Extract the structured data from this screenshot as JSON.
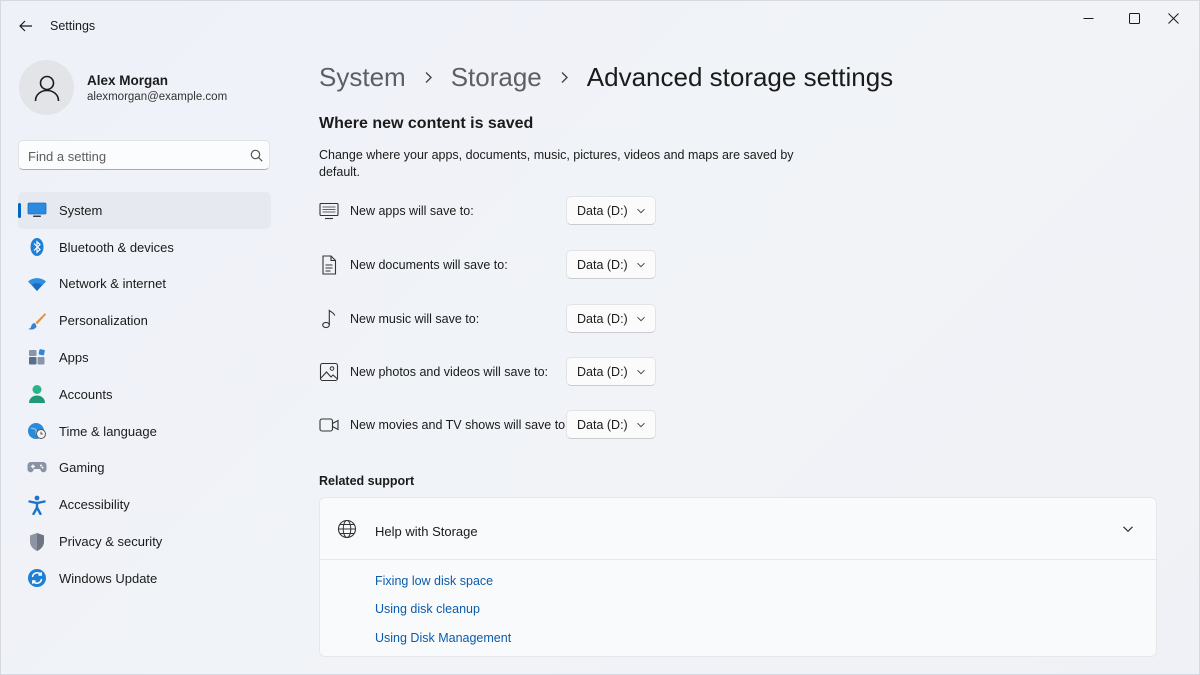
{
  "window": {
    "title": "Settings"
  },
  "profile": {
    "name": "Alex Morgan",
    "email": "alexmorgan@example.com"
  },
  "search": {
    "placeholder": "Find a setting"
  },
  "nav": {
    "selected": "System",
    "items": [
      {
        "label": "System",
        "icon": "monitor-icon"
      },
      {
        "label": "Bluetooth & devices",
        "icon": "bluetooth-icon"
      },
      {
        "label": "Network & internet",
        "icon": "wifi-icon"
      },
      {
        "label": "Personalization",
        "icon": "brush-icon"
      },
      {
        "label": "Apps",
        "icon": "apps-icon"
      },
      {
        "label": "Accounts",
        "icon": "person-icon"
      },
      {
        "label": "Time & language",
        "icon": "globe-clock-icon"
      },
      {
        "label": "Gaming",
        "icon": "gamepad-icon"
      },
      {
        "label": "Accessibility",
        "icon": "accessibility-icon"
      },
      {
        "label": "Privacy & security",
        "icon": "shield-icon"
      },
      {
        "label": "Windows Update",
        "icon": "sync-icon"
      }
    ]
  },
  "breadcrumb": {
    "items": [
      "System",
      "Storage"
    ],
    "current": "Advanced storage settings"
  },
  "content": {
    "section_title": "Where new content is saved",
    "section_desc": "Change where your apps, documents, music, pictures, videos and maps are saved by default.",
    "save_locations": [
      {
        "label": "New apps will save to:",
        "value": "Data (D:)",
        "icon": "monitor-icon"
      },
      {
        "label": "New documents will save to:",
        "value": "Data (D:)",
        "icon": "document-icon"
      },
      {
        "label": "New music will save to:",
        "value": "Data (D:)",
        "icon": "music-note-icon"
      },
      {
        "label": "New photos and videos will save to:",
        "value": "Data (D:)",
        "icon": "photo-icon"
      },
      {
        "label": "New movies and TV shows will save to:",
        "value": "Data (D:)",
        "icon": "video-camera-icon"
      }
    ]
  },
  "related": {
    "title": "Related support",
    "help_title": "Help with Storage",
    "links": [
      "Fixing low disk space",
      "Using disk cleanup",
      "Using Disk Management"
    ]
  },
  "colors": {
    "accent": "#0067c0",
    "link": "#0b5cad"
  }
}
